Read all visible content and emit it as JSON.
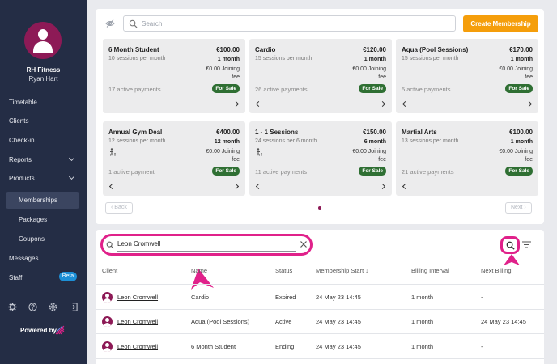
{
  "sidebar": {
    "org_name": "RH Fitness",
    "user_name": "Ryan Hart",
    "nav": [
      "Timetable",
      "Clients",
      "Check-in",
      "Reports",
      "Products"
    ],
    "sub": [
      "Memberships",
      "Packages",
      "Coupons"
    ],
    "nav2": [
      "Messages",
      "Staff"
    ],
    "beta": "Beta",
    "powered_by": "Powered by"
  },
  "toolbar": {
    "search_placeholder": "Search",
    "create_label": "Create Membership"
  },
  "memberships": [
    {
      "name": "6 Month Student",
      "price": "€100.00",
      "sessions": "10 sessions per month",
      "duration": "1 month",
      "fee_line1": "€0.00 Joining",
      "fee_line2": "fee",
      "active": "17 active payments",
      "badge": "For Sale"
    },
    {
      "name": "Cardio",
      "price": "€120.00",
      "sessions": "15 sessions per month",
      "duration": "1 month",
      "fee_line1": "€0.00 Joining",
      "fee_line2": "fee",
      "active": "26 active payments",
      "badge": "For Sale"
    },
    {
      "name": "Aqua (Pool Sessions)",
      "price": "€170.00",
      "sessions": "15 sessions per month",
      "duration": "1 month",
      "fee_line1": "€0.00 Joining",
      "fee_line2": "fee",
      "active": "5 active payments",
      "badge": "For Sale"
    },
    {
      "name": "Annual Gym Deal",
      "price": "€400.00",
      "sessions": "12 sessions per month",
      "duration": "12 month",
      "fee_line1": "€0.00 Joining",
      "fee_line2": "fee",
      "active": "1 active payment",
      "badge": "For Sale"
    },
    {
      "name": "1 - 1 Sessions",
      "price": "€150.00",
      "sessions": "24 sessions per 6 month",
      "duration": "6 month",
      "fee_line1": "€0.00 Joining",
      "fee_line2": "fee",
      "active": "11 active payments",
      "badge": "For Sale"
    },
    {
      "name": "Martial Arts",
      "price": "€100.00",
      "sessions": "13 sessions per month",
      "duration": "1 month",
      "fee_line1": "€0.00 Joining",
      "fee_line2": "fee",
      "active": "21 active payments",
      "badge": "For Sale"
    }
  ],
  "pagination": {
    "back": "Back",
    "next": "Next"
  },
  "filter": {
    "value": "Leon Cromwell"
  },
  "table": {
    "headers": [
      "Client",
      "Name",
      "Status",
      "Membership Start",
      "Billing Interval",
      "Next Billing"
    ],
    "rows": [
      {
        "client": "Leon Cromwell",
        "name": "Cardio",
        "status": "Expired",
        "start": "24 May 23 14:45",
        "interval": "1 month",
        "next": "-"
      },
      {
        "client": "Leon Cromwell",
        "name": "Aqua (Pool Sessions)",
        "status": "Active",
        "start": "24 May 23 14:45",
        "interval": "1 month",
        "next": "24 May 23 14:45"
      },
      {
        "client": "Leon Cromwell",
        "name": "6 Month Student",
        "status": "Ending",
        "start": "24 May 23 14:45",
        "interval": "1 month",
        "next": "-"
      }
    ]
  },
  "colors": {
    "sidebar": "#242d45",
    "brand": "#8d1a56",
    "accent": "#f59e0b",
    "highlight": "#e0218a",
    "for_sale": "#2f6f33"
  }
}
